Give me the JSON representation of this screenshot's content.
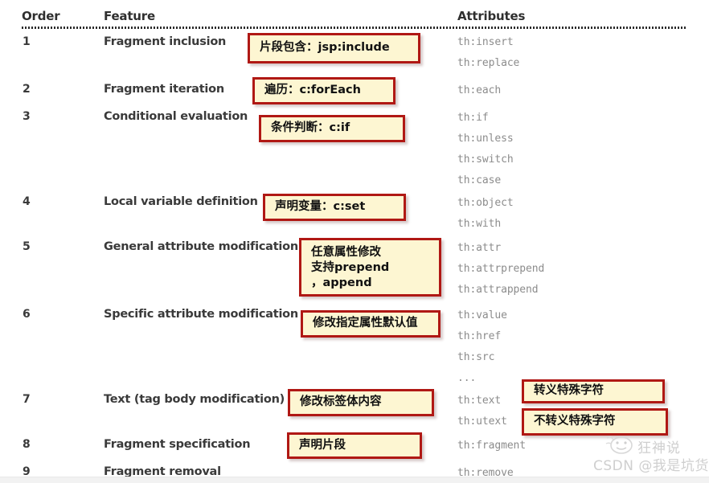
{
  "table": {
    "headers": {
      "order": "Order",
      "feature": "Feature",
      "attributes": "Attributes"
    },
    "rows": [
      {
        "order": "1",
        "feature": "Fragment inclusion",
        "attributes": [
          "th:insert",
          "th:replace"
        ]
      },
      {
        "order": "2",
        "feature": "Fragment iteration",
        "attributes": [
          "th:each"
        ]
      },
      {
        "order": "3",
        "feature": "Conditional evaluation",
        "attributes": [
          "th:if",
          "th:unless",
          "th:switch",
          "th:case"
        ]
      },
      {
        "order": "4",
        "feature": "Local variable definition",
        "attributes": [
          "th:object",
          "th:with"
        ]
      },
      {
        "order": "5",
        "feature": "General attribute modification",
        "attributes": [
          "th:attr",
          "th:attrprepend",
          "th:attrappend"
        ]
      },
      {
        "order": "6",
        "feature": "Specific attribute modification",
        "attributes": [
          "th:value",
          "th:href",
          "th:src",
          "..."
        ]
      },
      {
        "order": "7",
        "feature": "Text (tag body modification)",
        "attributes": [
          "th:text",
          "th:utext"
        ]
      },
      {
        "order": "8",
        "feature": "Fragment specification",
        "attributes": [
          "th:fragment"
        ]
      },
      {
        "order": "9",
        "feature": "Fragment removal",
        "attributes": [
          "th:remove"
        ]
      }
    ]
  },
  "annotations": [
    {
      "id": "fragment-inclusion",
      "text": "片段包含：jsp:include"
    },
    {
      "id": "fragment-iteration",
      "text": "遍历：c:forEach"
    },
    {
      "id": "conditional",
      "text": "条件判断：c:if"
    },
    {
      "id": "local-variable",
      "text": "声明变量：c:set"
    },
    {
      "id": "general-attribute",
      "text": "任意属性修改\n支持prepend\n，append"
    },
    {
      "id": "specific-attribute",
      "text": "修改指定属性默认值"
    },
    {
      "id": "text-body",
      "text": "修改标签体内容"
    },
    {
      "id": "escape-special",
      "text": "转义特殊字符"
    },
    {
      "id": "unescape-special",
      "text": "不转义特殊字符"
    },
    {
      "id": "fragment-spec",
      "text": "声明片段"
    }
  ],
  "watermark": {
    "brand": "狂神说",
    "credit": "CSDN @我是坑货"
  },
  "colors": {
    "callout_fill": "#fdf6d2",
    "callout_border": "#b01814",
    "text": "#3a3a3a",
    "attribute_text": "#8c8c8c",
    "watermark": "#cfcfcf"
  }
}
